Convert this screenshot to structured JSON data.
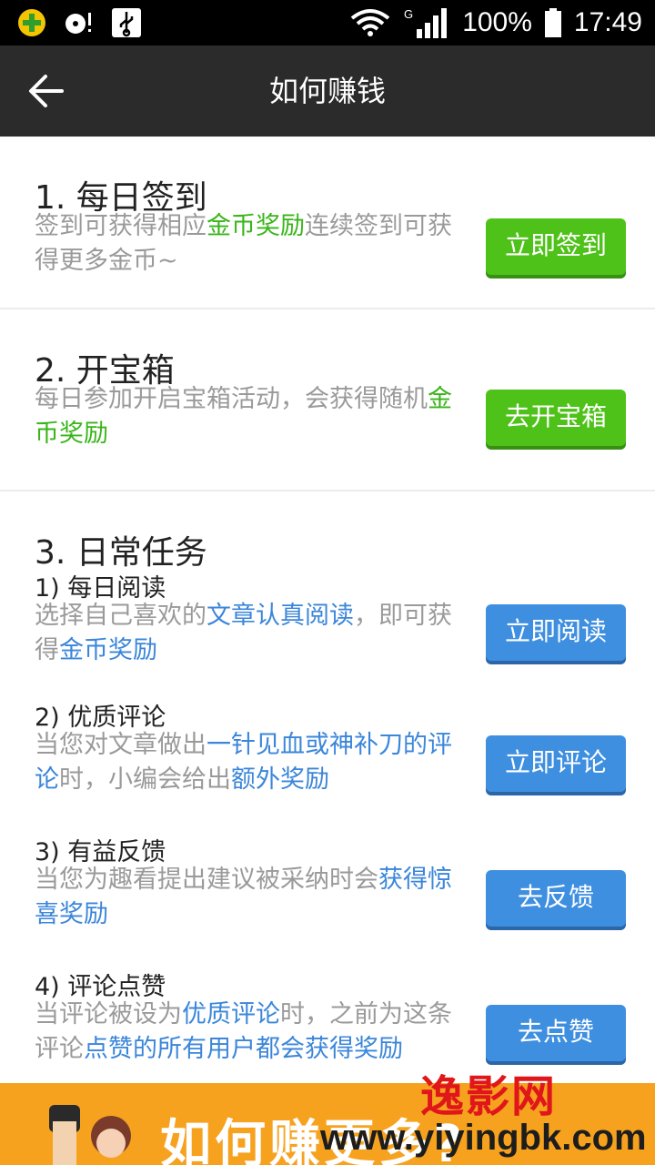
{
  "status_bar": {
    "battery": "100%",
    "time": "17:49",
    "network": "G"
  },
  "app_bar": {
    "title": "如何赚钱"
  },
  "sections": {
    "checkin": {
      "title": "1. 每日签到",
      "desc_1": "签到可获得相应",
      "desc_hl": "金币奖励",
      "desc_2": "连续签到可获得更多金币~",
      "button": "立即签到"
    },
    "treasure": {
      "title": "2. 开宝箱",
      "desc_1": "每日参加开启宝箱活动，会获得随机",
      "desc_hl": "金币奖励",
      "button": "去开宝箱"
    },
    "daily": {
      "title": "3. 日常任务",
      "tasks": [
        {
          "title": "1) 每日阅读",
          "p1": "选择自己喜欢的",
          "h1": "文章认真阅读",
          "p2": "，即可获得",
          "h2": "金币奖励",
          "button": "立即阅读"
        },
        {
          "title": "2) 优质评论",
          "p1": "当您对文章做出",
          "h1": "一针见血或神补刀的评论",
          "p2": "时，小编会给出",
          "h2": "额外奖励",
          "button": "立即评论"
        },
        {
          "title": "3) 有益反馈",
          "p1": "当您为趣看提出建议被采纳时会",
          "h1": "获得惊喜奖励",
          "button": "去反馈"
        },
        {
          "title": "4) 评论点赞",
          "p1": "当评论被设为",
          "h1": "优质评论",
          "p2": "时，之前为这条评论",
          "h2": "点赞的所有用户都会获得奖励",
          "button": "去点赞"
        }
      ]
    }
  },
  "banner": {
    "text": "如何赚更多?"
  },
  "watermark": {
    "line1": "逸影网",
    "line2": "www.yiyingbk.com"
  },
  "colors": {
    "green": "#4fc21a",
    "blue": "#3f8fe0",
    "banner": "#f6a21e",
    "appbar": "#2b2b2b"
  }
}
